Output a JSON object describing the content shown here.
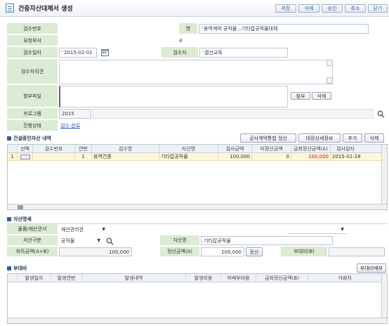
{
  "header": {
    "title": "건중자산대체서 생성",
    "buttons": [
      "저장",
      "삭제",
      "승인",
      "취소",
      "닫기"
    ]
  },
  "form": {
    "labels": {
      "inspection_no": "검수번호",
      "request_dept": "요청부서",
      "inspection_date": "검수일자",
      "inspector": "검수자",
      "opinion": "검수자의견",
      "attachment": "첨부파일",
      "program": "프로그램",
      "progress": "진행상태",
      "item_name_suffix": "명"
    },
    "values": {
      "item_name": "용역계약 공작물...기타잡공작물대체",
      "request_dept_value": "4",
      "inspection_date": "2015-02-01",
      "inspector": "결산교육",
      "program": "2015",
      "progress": "검수-완료"
    },
    "attach_buttons": [
      "첨부",
      "삭제"
    ]
  },
  "asset_section": {
    "title": "건설중인자산 내역",
    "buttons": [
      "공사계약통합 정산",
      "대장상세정보",
      "추가",
      "삭제"
    ],
    "columns": [
      "선택",
      "검수번호",
      "연번",
      "검수명",
      "자산명",
      "검사금액",
      "미정산금액",
      "금회정산금액(A)",
      "검사일자"
    ],
    "rows": [
      {
        "rownum": "1",
        "no": "1",
        "name": "용역건중",
        "asset": "기타잡공작물",
        "amount": "100,000",
        "unsettled": "0",
        "settle": "100,000",
        "date": "2015-01-28"
      }
    ]
  },
  "detail_section": {
    "title": "자산명세",
    "labels": {
      "category": "물품/재산관서",
      "asset_type": "자산구분",
      "asset_name": "자산명",
      "acq_amount": "취득금액(A+B)",
      "settle_amount": "정산금액(A)",
      "extra_cost": "부대비(B)"
    },
    "values": {
      "category": "재산관리관",
      "asset_type": "공작물",
      "asset_name": "기타잡공작물",
      "acq_amount": "100,000",
      "settle_amount": "100,000"
    },
    "settle_button": "정산"
  },
  "extra_section": {
    "title": "부대비",
    "button": "부대비배부",
    "columns": [
      "발생일자",
      "발생연번",
      "발생내역",
      "발생비용",
      "미배부비용",
      "금회정산금액(B)",
      "거래처"
    ]
  }
}
